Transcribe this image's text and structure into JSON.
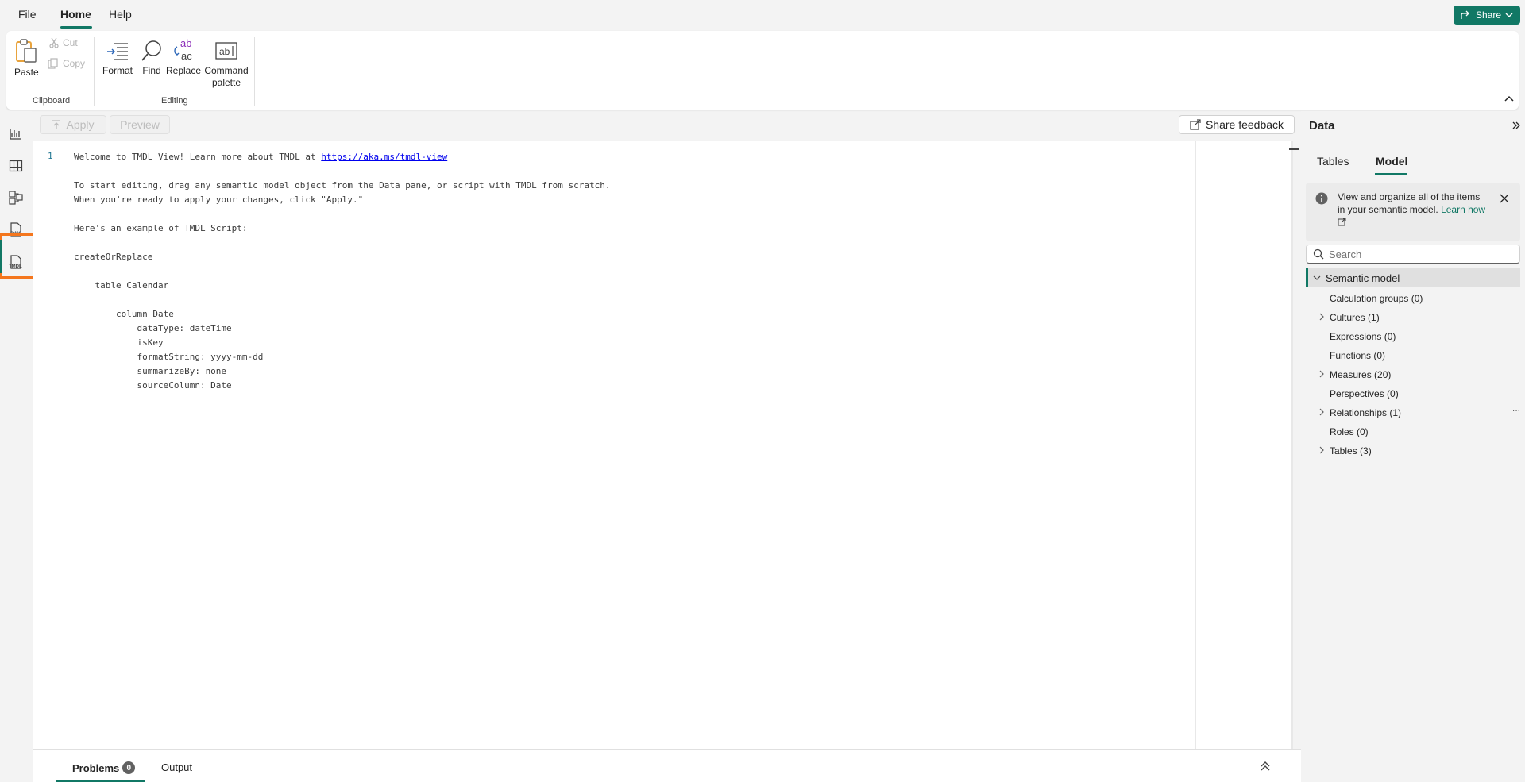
{
  "menu": {
    "items": [
      {
        "label": "File"
      },
      {
        "label": "Home"
      },
      {
        "label": "Help"
      }
    ],
    "share_label": "Share"
  },
  "ribbon": {
    "clipboard": {
      "paste": "Paste",
      "cut": "Cut",
      "copy": "Copy",
      "group_label": "Clipboard"
    },
    "editing": {
      "format": "Format",
      "find": "Find",
      "replace": "Replace",
      "command_palette_line1": "Command",
      "command_palette_line2": "palette",
      "group_label": "Editing"
    }
  },
  "rail": {
    "icons": [
      "report-view-icon",
      "table-view-icon",
      "model-view-icon",
      "dax-query-view-icon",
      "tmdl-view-icon"
    ],
    "selected": "tmdl-view-icon"
  },
  "toolbar": {
    "apply": "Apply",
    "preview": "Preview",
    "share_feedback": "Share feedback"
  },
  "editor": {
    "line_number": "1",
    "lines": [
      "To start editing, drag any semantic model object from the Data pane, or script with TMDL from scratch.",
      "When you're ready to apply your changes, click \"Apply.\"",
      "",
      "Here's an example of TMDL Script:",
      "",
      "createOrReplace",
      "",
      "    table Calendar",
      "",
      "        column Date",
      "            dataType: dateTime",
      "            isKey",
      "            formatString: yyyy-mm-dd",
      "            summarizeBy: none",
      "            sourceColumn: Date"
    ],
    "welcome_prefix": "Welcome to TMDL View! Learn more about TMDL at ",
    "welcome_link": "https://aka.ms/tmdl-view"
  },
  "bottom_panel": {
    "problems_label": "Problems",
    "problems_count": "0",
    "output_label": "Output"
  },
  "data_pane": {
    "title": "Data",
    "tabs": [
      {
        "label": "Tables"
      },
      {
        "label": "Model"
      }
    ],
    "active_tab": "Model",
    "info_text": "View and organize all of the items in your semantic model. ",
    "info_link": "Learn how",
    "search_placeholder": "Search",
    "tree_root": "Semantic model",
    "tree_items": [
      {
        "label": "Calculation groups (0)",
        "expandable": false
      },
      {
        "label": "Cultures (1)",
        "expandable": true
      },
      {
        "label": "Expressions (0)",
        "expandable": false
      },
      {
        "label": "Functions (0)",
        "expandable": false
      },
      {
        "label": "Measures (20)",
        "expandable": true
      },
      {
        "label": "Perspectives (0)",
        "expandable": false
      },
      {
        "label": "Relationships (1)",
        "expandable": true
      },
      {
        "label": "Roles (0)",
        "expandable": false
      },
      {
        "label": "Tables (3)",
        "expandable": true
      }
    ],
    "more_options": "···"
  },
  "colors": {
    "accent": "#117865",
    "selection_highlight": "#f4761d",
    "link": "#0000ee"
  }
}
